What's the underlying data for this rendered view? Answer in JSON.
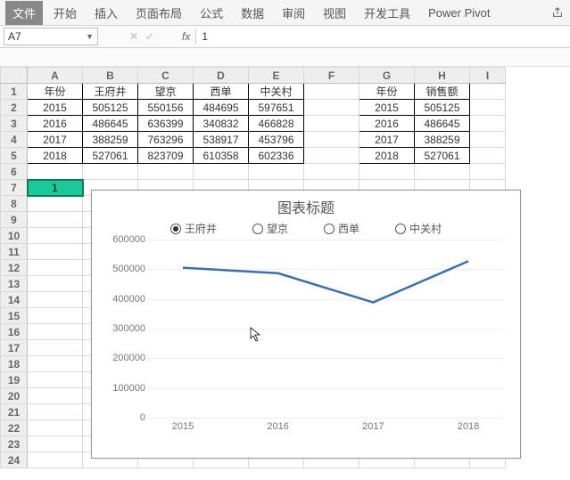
{
  "ribbon": {
    "tabs": [
      "文件",
      "开始",
      "插入",
      "页面布局",
      "公式",
      "数据",
      "审阅",
      "视图",
      "开发工具",
      "Power Pivot"
    ]
  },
  "namebox": {
    "value": "A7"
  },
  "formula": {
    "value": "1"
  },
  "sheet": {
    "cols": [
      "A",
      "B",
      "C",
      "D",
      "E",
      "F",
      "G",
      "H",
      "I"
    ],
    "rows": 24,
    "selected": "A7",
    "selected_value": "1",
    "table1": {
      "range": "A1:E5",
      "header": [
        "年份",
        "王府井",
        "望京",
        "西单",
        "中关村"
      ],
      "data": [
        [
          "2015",
          "505125",
          "550156",
          "484695",
          "597651"
        ],
        [
          "2016",
          "486645",
          "636399",
          "340832",
          "466828"
        ],
        [
          "2017",
          "388259",
          "763296",
          "538917",
          "453796"
        ],
        [
          "2018",
          "527061",
          "823709",
          "610358",
          "602336"
        ]
      ]
    },
    "table2": {
      "range": "G1:H5",
      "header": [
        "年份",
        "销售额"
      ],
      "data": [
        [
          "2015",
          "505125"
        ],
        [
          "2016",
          "486645"
        ],
        [
          "2017",
          "388259"
        ],
        [
          "2018",
          "527061"
        ]
      ]
    }
  },
  "chart_data": {
    "type": "line",
    "title": "图表标题",
    "legend": [
      "王府井",
      "望京",
      "西单",
      "中关村"
    ],
    "selected_series": "王府井",
    "categories": [
      "2015",
      "2016",
      "2017",
      "2018"
    ],
    "series": [
      {
        "name": "王府井",
        "values": [
          505125,
          486645,
          388259,
          527061
        ]
      }
    ],
    "ylim": [
      0,
      600000
    ],
    "yticks": [
      0,
      100000,
      200000,
      300000,
      400000,
      500000,
      600000
    ],
    "xlabel": "",
    "ylabel": ""
  }
}
